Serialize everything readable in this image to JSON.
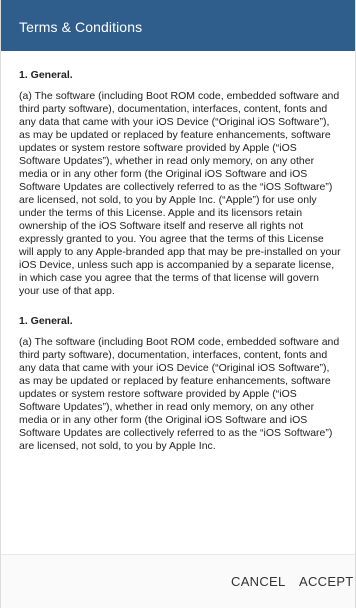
{
  "dialog": {
    "title": "Terms & Conditions",
    "sections": [
      {
        "heading": "1. General.",
        "body": "(a) The software (including Boot ROM code, embedded software and third party software), documentation, interfaces, content, fonts and any data that came with your iOS Device (“Original iOS Software”), as may be updated or replaced by feature enhancements, software updates or system restore software provided by Apple (“iOS Software Updates”), whether in read only memory, on any other media or in any other form (the Original iOS Software and iOS Software Updates are collectively referred to as the “iOS Software”) are licensed, not sold, to you by Apple Inc. (“Apple”) for use only under the terms of this License. Apple and its licensors retain ownership of the iOS Software itself and reserve all rights not expressly granted to you. You agree that the terms of this License will apply to any Apple-branded app that may be pre-installed on your iOS Device, unless such app is accompanied by a separate license, in which case you agree that the terms of that license will govern your use of that app."
      },
      {
        "heading": "1. General.",
        "body": "(a) The software (including Boot ROM code, embedded software and third party software), documentation, interfaces, content, fonts and any data that came with your iOS Device (“Original iOS Software”), as may be updated or replaced by feature enhancements, software updates or system restore software provided by Apple (“iOS Software Updates”), whether in read only memory, on any other media or in any other form (the Original iOS Software and iOS Software Updates are collectively referred to as the “iOS Software”) are licensed, not sold, to you by Apple Inc."
      }
    ],
    "buttons": {
      "cancel_label": "CANCEL",
      "accept_label": "ACCEPT"
    }
  },
  "colors": {
    "header_background": "#2f5d8c",
    "header_text": "#ffffff",
    "body_text": "#222222",
    "button_text": "#333333"
  }
}
